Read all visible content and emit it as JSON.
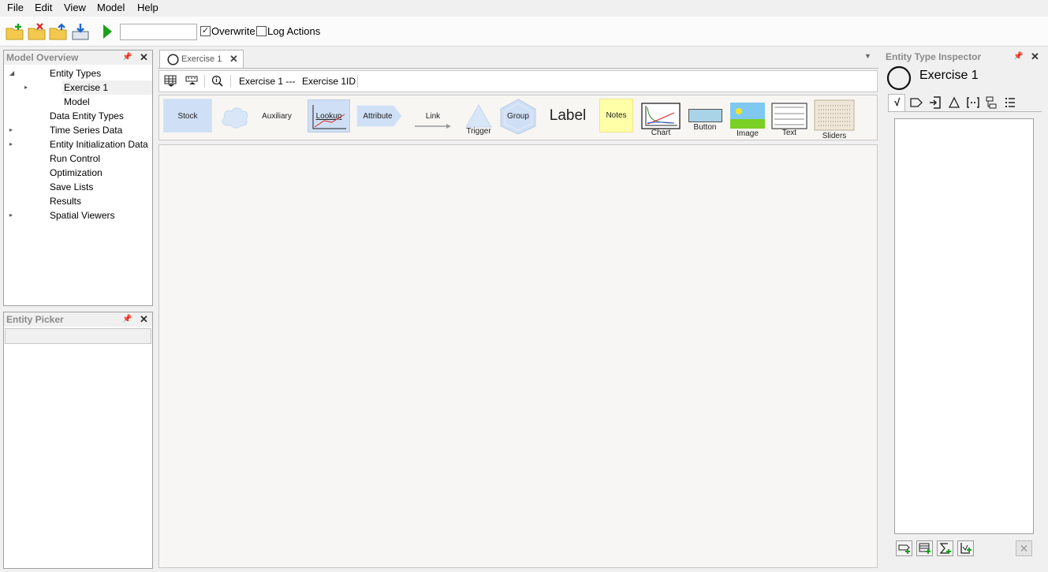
{
  "menu": [
    "File",
    "Edit",
    "View",
    "Model",
    "Help"
  ],
  "toolbar": {
    "run_name_value": "",
    "overwrite_label": "Overwrite",
    "overwrite_checked": "✓",
    "log_actions_label": "Log Actions"
  },
  "model_overview": {
    "title": "Model Overview",
    "tree": [
      {
        "label": "Entity Types"
      },
      {
        "label": "Exercise 1"
      },
      {
        "label": "Model"
      },
      {
        "label": "Data Entity Types"
      },
      {
        "label": "Time Series Data"
      },
      {
        "label": "Entity Initialization Data"
      },
      {
        "label": "Run Control"
      },
      {
        "label": "Optimization"
      },
      {
        "label": "Save Lists"
      },
      {
        "label": "Results"
      },
      {
        "label": "Spatial Viewers"
      }
    ]
  },
  "entity_picker": {
    "title": "Entity Picker"
  },
  "document": {
    "tab_label": "Exercise 1",
    "breadcrumb_name": "Exercise 1 ---",
    "breadcrumb_id": "Exercise 1ID"
  },
  "palette": {
    "stock": "Stock",
    "auxiliary": "Auxiliary",
    "lookup": "Lookup",
    "attribute": "Attribute",
    "link": "Link",
    "trigger": "Trigger",
    "group": "Group",
    "label": "Label",
    "notes": "Notes",
    "chart": "Chart",
    "button": "Button",
    "image": "Image",
    "text": "Text",
    "sliders": "Sliders"
  },
  "inspector": {
    "title": "Entity Type Inspector",
    "entity_name": "Exercise 1"
  },
  "icons": {
    "new": "folder-new-icon",
    "delete": "folder-delete-icon",
    "open": "folder-open-icon",
    "save": "save-icon",
    "run": "run-icon"
  },
  "colors": {
    "run_green": "#1aa31a",
    "accent_blue": "#cfe0f5",
    "notes_yellow": "#ffffa8"
  }
}
